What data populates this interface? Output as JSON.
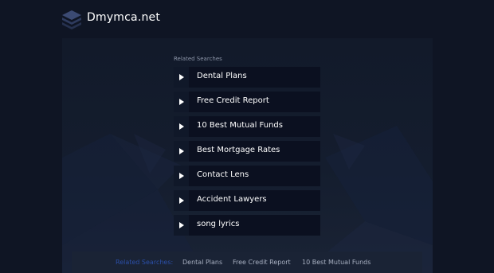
{
  "header": {
    "logo_icon": "stacked-layers-icon",
    "site_name": "Dmymca.net"
  },
  "related": {
    "label": "Related Searches",
    "items": [
      {
        "label": "Dental Plans"
      },
      {
        "label": "Free Credit Report"
      },
      {
        "label": "10 Best Mutual Funds"
      },
      {
        "label": "Best Mortgage Rates"
      },
      {
        "label": "Contact Lens"
      },
      {
        "label": "Accident Lawyers"
      },
      {
        "label": "song lyrics"
      }
    ],
    "item_icon": "play-arrow-icon"
  },
  "footer": {
    "label": "Related Searches:",
    "links": [
      "Dental Plans",
      "Free Credit Report",
      "10 Best Mutual Funds"
    ]
  },
  "colors": {
    "background": "#0f1524",
    "item_background": "#0b1020",
    "footer_label": "#2b4fa8"
  }
}
